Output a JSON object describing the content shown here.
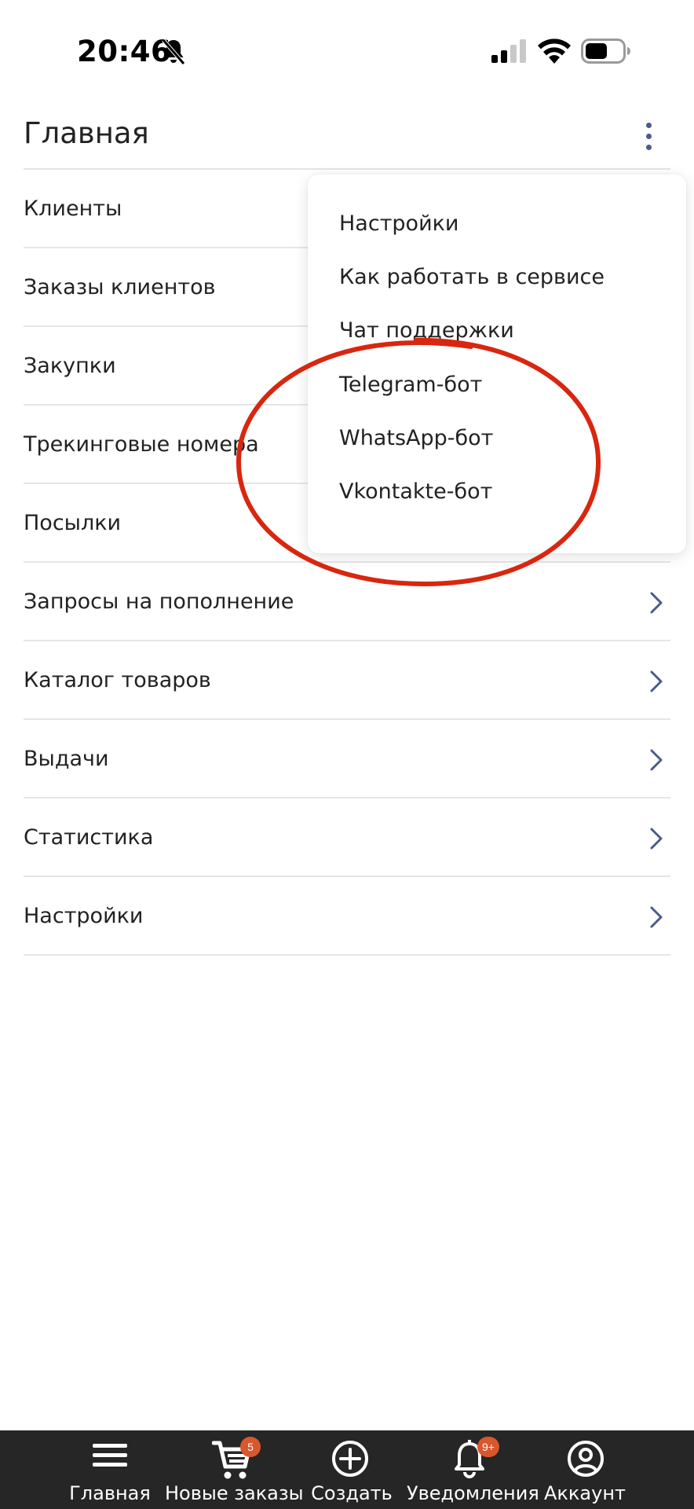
{
  "status_bar": {
    "time": "20:46",
    "icons": [
      "bell-slash-icon",
      "cellular-signal-icon",
      "wifi-icon",
      "battery-icon"
    ]
  },
  "header": {
    "title": "Главная",
    "more_icon": "more-vertical-icon",
    "accent_color": "#4c5a8a"
  },
  "menu": {
    "items": [
      {
        "label": "Клиенты"
      },
      {
        "label": "Заказы клиентов"
      },
      {
        "label": "Закупки"
      },
      {
        "label": "Трекинговые номера"
      },
      {
        "label": "Посылки"
      },
      {
        "label": "Запросы на пополнение"
      },
      {
        "label": "Каталог товаров"
      },
      {
        "label": "Выдачи"
      },
      {
        "label": "Статистика"
      },
      {
        "label": "Настройки"
      }
    ]
  },
  "dropdown": {
    "items": [
      {
        "label": "Настройки"
      },
      {
        "label": "Как работать в сервисе"
      },
      {
        "label": "Чат поддержки"
      },
      {
        "label": "Telegram-бот"
      },
      {
        "label": "WhatsApp-бот"
      },
      {
        "label": "Vkontakte-бот"
      }
    ]
  },
  "annotation_color": "#d9260f",
  "bottom_nav": {
    "items": [
      {
        "label": "Главная",
        "icon": "menu-icon"
      },
      {
        "label": "Новые заказы",
        "icon": "cart-icon",
        "badge": "5"
      },
      {
        "label": "Создать",
        "icon": "plus-circle-icon"
      },
      {
        "label": "Уведомления",
        "icon": "bell-icon",
        "badge": "9+"
      },
      {
        "label": "Аккаунт",
        "icon": "account-circle-icon"
      }
    ],
    "badge_color": "#d9572d"
  }
}
